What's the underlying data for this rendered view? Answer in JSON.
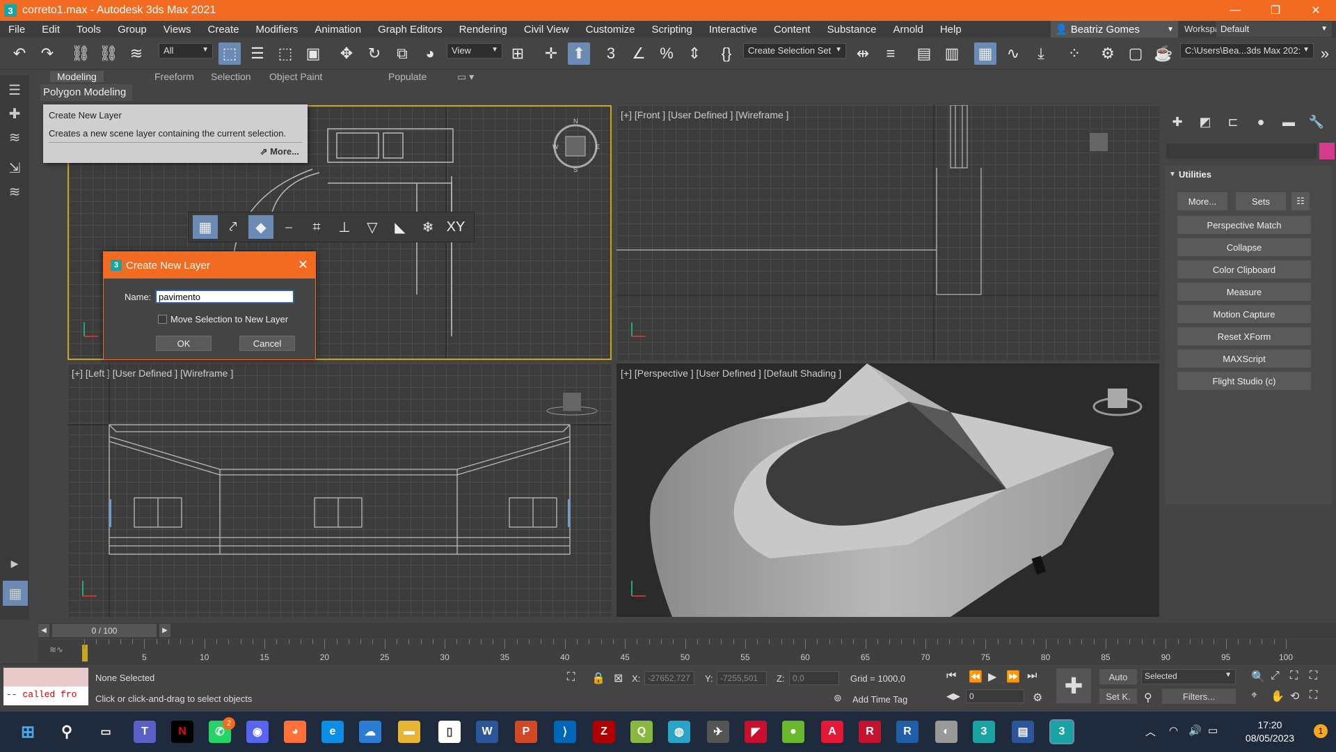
{
  "window": {
    "title": "correto1.max - Autodesk 3ds Max 2021",
    "app_icon": "3",
    "minimize": "—",
    "maximize": "❐",
    "close": "✕"
  },
  "menu": {
    "items": [
      "File",
      "Edit",
      "Tools",
      "Group",
      "Views",
      "Create",
      "Modifiers",
      "Animation",
      "Graph Editors",
      "Rendering",
      "Civil View",
      "Customize",
      "Scripting",
      "Interactive",
      "Content",
      "Substance",
      "Arnold",
      "Help"
    ],
    "user": "Beatriz Gomes",
    "workspaces_label": "Workspaces:",
    "workspace": "Default"
  },
  "toolbar": {
    "filter": "All",
    "ref_coord": "View",
    "selection_set": "Create Selection Set",
    "project_path": "C:\\Users\\Bea...3ds Max 202:"
  },
  "ribbon": {
    "tabs": [
      "Modeling",
      "Freeform",
      "Selection",
      "Object Paint",
      "Populate"
    ],
    "active_tab": "Modeling",
    "panel": "Polygon Modeling"
  },
  "tooltip": {
    "title": "Create New Layer",
    "description": "Creates a new scene layer containing the current selection.",
    "more": "More..."
  },
  "dialog": {
    "title": "Create New Layer",
    "name_label": "Name:",
    "name_value": "pavimento",
    "checkbox_label": "Move Selection to New Layer",
    "checkbox_checked": false,
    "ok": "OK",
    "cancel": "Cancel"
  },
  "viewports": {
    "front": "[+] [Front ] [User Defined ] [Wireframe ]",
    "left": "[+] [Left ] [User Defined ] [Wireframe ]",
    "perspective": "[+] [Perspective ] [User Defined ] [Default Shading ]"
  },
  "command_panel": {
    "rollout_title": "Utilities",
    "more": "More...",
    "sets": "Sets",
    "utilities": [
      "Perspective Match",
      "Collapse",
      "Color Clipboard",
      "Measure",
      "Motion Capture",
      "Reset XForm",
      "MAXScript",
      "Flight Studio (c)"
    ],
    "swatch_color": "#d43a8e"
  },
  "timeline": {
    "frame": "0 / 100",
    "ticks": [
      "5",
      "10",
      "15",
      "20",
      "25",
      "30",
      "35",
      "40",
      "45",
      "50",
      "55",
      "60",
      "65",
      "70",
      "75",
      "80",
      "85",
      "90",
      "95",
      "100"
    ]
  },
  "status": {
    "maxscript_output": "-- called fro",
    "selection": "None Selected",
    "prompt": "Click or click-and-drag to select objects",
    "x_label": "X:",
    "x_value": "-27652,727",
    "y_label": "Y:",
    "y_value": "-7255,501",
    "z_label": "Z:",
    "z_value": "0,0",
    "grid": "Grid = 1000,0",
    "add_time_tag": "Add Time Tag",
    "auto": "Auto",
    "set_key": "Set K.",
    "key_filter": "Selected",
    "filters": "Filters...",
    "current_frame": "0"
  },
  "taskbar": {
    "time": "17:20",
    "date": "08/05/2023",
    "notifications": "1",
    "whatsapp_badge": "2"
  }
}
